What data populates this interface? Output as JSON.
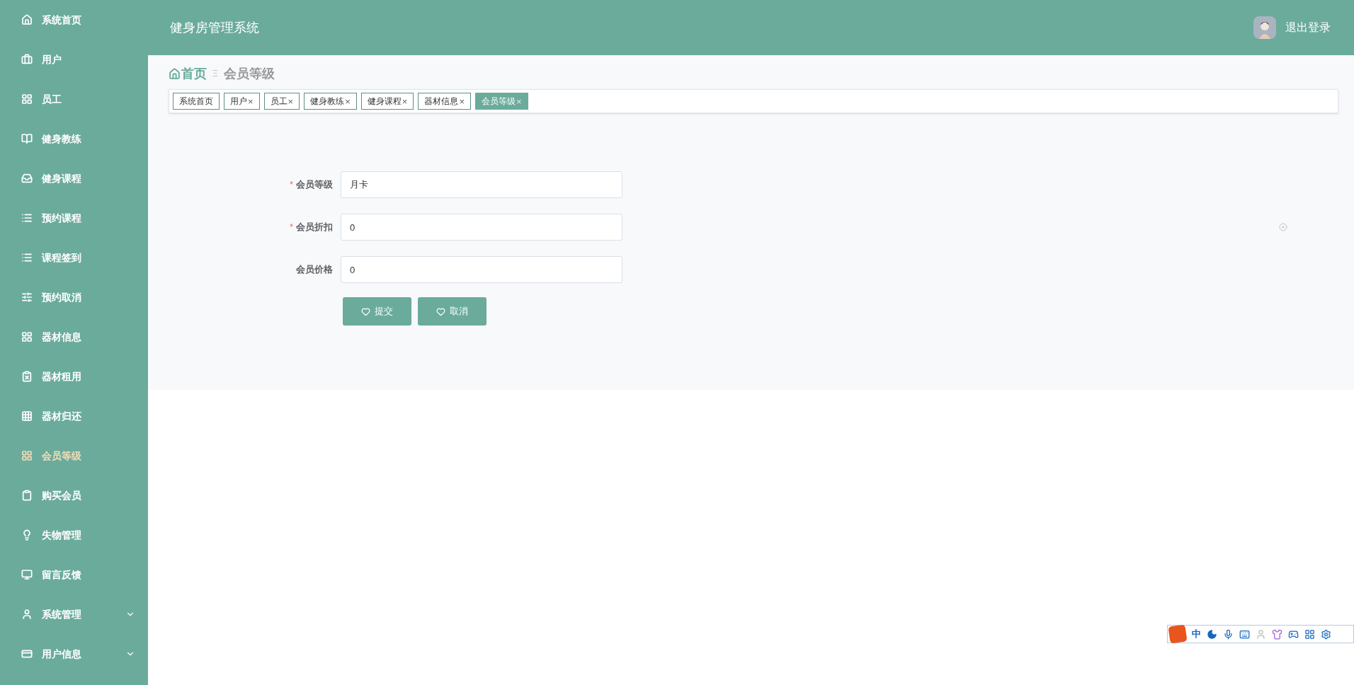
{
  "sidebar": {
    "items": [
      {
        "label": "系统首页",
        "selected": false,
        "expandable": false
      },
      {
        "label": "用户",
        "selected": false,
        "expandable": false
      },
      {
        "label": "员工",
        "selected": false,
        "expandable": false
      },
      {
        "label": "健身教练",
        "selected": false,
        "expandable": false
      },
      {
        "label": "健身课程",
        "selected": false,
        "expandable": false
      },
      {
        "label": "预约课程",
        "selected": false,
        "expandable": false
      },
      {
        "label": "课程签到",
        "selected": false,
        "expandable": false
      },
      {
        "label": "预约取消",
        "selected": false,
        "expandable": false
      },
      {
        "label": "器材信息",
        "selected": false,
        "expandable": false
      },
      {
        "label": "器材租用",
        "selected": false,
        "expandable": false
      },
      {
        "label": "器材归还",
        "selected": false,
        "expandable": false
      },
      {
        "label": "会员等级",
        "selected": true,
        "expandable": false
      },
      {
        "label": "购买会员",
        "selected": false,
        "expandable": false
      },
      {
        "label": "失物管理",
        "selected": false,
        "expandable": false
      },
      {
        "label": "留言反馈",
        "selected": false,
        "expandable": false
      },
      {
        "label": "系统管理",
        "selected": false,
        "expandable": true
      },
      {
        "label": "用户信息",
        "selected": false,
        "expandable": true
      }
    ]
  },
  "header": {
    "title": "健身房管理系统",
    "logout": "退出登录"
  },
  "breadcrumb": {
    "home": "首页",
    "separator": "Ξ",
    "current": "会员等级"
  },
  "tabs": [
    {
      "label": "系统首页",
      "selected": false
    },
    {
      "label": "用户",
      "close": "×",
      "selected": false
    },
    {
      "label": "员工",
      "close": "×",
      "selected": false
    },
    {
      "label": "健身教练",
      "close": "×",
      "selected": false
    },
    {
      "label": "健身课程",
      "close": "×",
      "selected": false
    },
    {
      "label": "器材信息",
      "close": "×",
      "selected": false
    },
    {
      "label": "会员等级",
      "close": "×",
      "selected": true
    }
  ],
  "form": {
    "fields": [
      {
        "label": "会员等级",
        "required_mark": "*",
        "value": "月卡"
      },
      {
        "label": "会员折扣",
        "required_mark": "*",
        "value": "0"
      },
      {
        "label": "会员价格",
        "value": "0"
      }
    ],
    "buttons": [
      "提交",
      "取消"
    ]
  },
  "ime_toolbar": {
    "language": "中"
  }
}
